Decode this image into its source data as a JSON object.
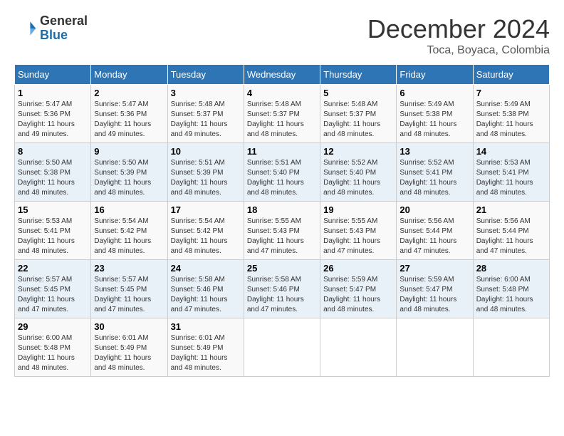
{
  "logo": {
    "text_general": "General",
    "text_blue": "Blue"
  },
  "title": "December 2024",
  "subtitle": "Toca, Boyaca, Colombia",
  "days_header": [
    "Sunday",
    "Monday",
    "Tuesday",
    "Wednesday",
    "Thursday",
    "Friday",
    "Saturday"
  ],
  "weeks": [
    [
      {
        "num": "1",
        "info": "Sunrise: 5:47 AM\nSunset: 5:36 PM\nDaylight: 11 hours\nand 49 minutes."
      },
      {
        "num": "2",
        "info": "Sunrise: 5:47 AM\nSunset: 5:36 PM\nDaylight: 11 hours\nand 49 minutes."
      },
      {
        "num": "3",
        "info": "Sunrise: 5:48 AM\nSunset: 5:37 PM\nDaylight: 11 hours\nand 49 minutes."
      },
      {
        "num": "4",
        "info": "Sunrise: 5:48 AM\nSunset: 5:37 PM\nDaylight: 11 hours\nand 48 minutes."
      },
      {
        "num": "5",
        "info": "Sunrise: 5:48 AM\nSunset: 5:37 PM\nDaylight: 11 hours\nand 48 minutes."
      },
      {
        "num": "6",
        "info": "Sunrise: 5:49 AM\nSunset: 5:38 PM\nDaylight: 11 hours\nand 48 minutes."
      },
      {
        "num": "7",
        "info": "Sunrise: 5:49 AM\nSunset: 5:38 PM\nDaylight: 11 hours\nand 48 minutes."
      }
    ],
    [
      {
        "num": "8",
        "info": "Sunrise: 5:50 AM\nSunset: 5:38 PM\nDaylight: 11 hours\nand 48 minutes."
      },
      {
        "num": "9",
        "info": "Sunrise: 5:50 AM\nSunset: 5:39 PM\nDaylight: 11 hours\nand 48 minutes."
      },
      {
        "num": "10",
        "info": "Sunrise: 5:51 AM\nSunset: 5:39 PM\nDaylight: 11 hours\nand 48 minutes."
      },
      {
        "num": "11",
        "info": "Sunrise: 5:51 AM\nSunset: 5:40 PM\nDaylight: 11 hours\nand 48 minutes."
      },
      {
        "num": "12",
        "info": "Sunrise: 5:52 AM\nSunset: 5:40 PM\nDaylight: 11 hours\nand 48 minutes."
      },
      {
        "num": "13",
        "info": "Sunrise: 5:52 AM\nSunset: 5:41 PM\nDaylight: 11 hours\nand 48 minutes."
      },
      {
        "num": "14",
        "info": "Sunrise: 5:53 AM\nSunset: 5:41 PM\nDaylight: 11 hours\nand 48 minutes."
      }
    ],
    [
      {
        "num": "15",
        "info": "Sunrise: 5:53 AM\nSunset: 5:41 PM\nDaylight: 11 hours\nand 48 minutes."
      },
      {
        "num": "16",
        "info": "Sunrise: 5:54 AM\nSunset: 5:42 PM\nDaylight: 11 hours\nand 48 minutes."
      },
      {
        "num": "17",
        "info": "Sunrise: 5:54 AM\nSunset: 5:42 PM\nDaylight: 11 hours\nand 48 minutes."
      },
      {
        "num": "18",
        "info": "Sunrise: 5:55 AM\nSunset: 5:43 PM\nDaylight: 11 hours\nand 47 minutes."
      },
      {
        "num": "19",
        "info": "Sunrise: 5:55 AM\nSunset: 5:43 PM\nDaylight: 11 hours\nand 47 minutes."
      },
      {
        "num": "20",
        "info": "Sunrise: 5:56 AM\nSunset: 5:44 PM\nDaylight: 11 hours\nand 47 minutes."
      },
      {
        "num": "21",
        "info": "Sunrise: 5:56 AM\nSunset: 5:44 PM\nDaylight: 11 hours\nand 47 minutes."
      }
    ],
    [
      {
        "num": "22",
        "info": "Sunrise: 5:57 AM\nSunset: 5:45 PM\nDaylight: 11 hours\nand 47 minutes."
      },
      {
        "num": "23",
        "info": "Sunrise: 5:57 AM\nSunset: 5:45 PM\nDaylight: 11 hours\nand 47 minutes."
      },
      {
        "num": "24",
        "info": "Sunrise: 5:58 AM\nSunset: 5:46 PM\nDaylight: 11 hours\nand 47 minutes."
      },
      {
        "num": "25",
        "info": "Sunrise: 5:58 AM\nSunset: 5:46 PM\nDaylight: 11 hours\nand 47 minutes."
      },
      {
        "num": "26",
        "info": "Sunrise: 5:59 AM\nSunset: 5:47 PM\nDaylight: 11 hours\nand 48 minutes."
      },
      {
        "num": "27",
        "info": "Sunrise: 5:59 AM\nSunset: 5:47 PM\nDaylight: 11 hours\nand 48 minutes."
      },
      {
        "num": "28",
        "info": "Sunrise: 6:00 AM\nSunset: 5:48 PM\nDaylight: 11 hours\nand 48 minutes."
      }
    ],
    [
      {
        "num": "29",
        "info": "Sunrise: 6:00 AM\nSunset: 5:48 PM\nDaylight: 11 hours\nand 48 minutes."
      },
      {
        "num": "30",
        "info": "Sunrise: 6:01 AM\nSunset: 5:49 PM\nDaylight: 11 hours\nand 48 minutes."
      },
      {
        "num": "31",
        "info": "Sunrise: 6:01 AM\nSunset: 5:49 PM\nDaylight: 11 hours\nand 48 minutes."
      },
      {
        "num": "",
        "info": ""
      },
      {
        "num": "",
        "info": ""
      },
      {
        "num": "",
        "info": ""
      },
      {
        "num": "",
        "info": ""
      }
    ]
  ]
}
